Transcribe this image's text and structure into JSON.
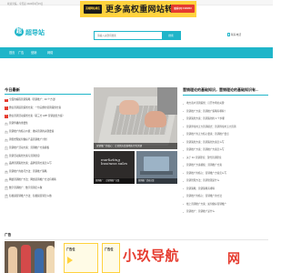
{
  "topbar": {
    "greeting": "欢迎光临，今天是 2024年4月15日"
  },
  "top_ad": {
    "tag": "高端网站域名",
    "headline": "更多高权重网站转让",
    "qq": "联系QQ:4110213"
  },
  "header": {
    "logo_mark": "超",
    "logo_name": "超导站",
    "search_placeholder": "请输入关键词搜索",
    "search_button": "搜索",
    "phone": "联系电话"
  },
  "nav": {
    "items": [
      "首页",
      "广告",
      "营销",
      "网络"
    ]
  },
  "today": {
    "title": "今日最新",
    "items": [
      "全面的编程营销策略（营销推广：40 个方法）",
      "微信营销运营策划方案：一份完整的营销策划方案",
      "微信营销活动策划方案（第三方 APP 营销最优方案）",
      "营销传播的重要性",
      "营销推广的核心价值：做好营销的关键要素",
      "销售经理如何做好产品营销推广计划",
      "营销推广活动方案：营销推广方案模板",
      "营销活动策划方案与营销创意",
      "品牌营销策划方案：品牌营销方案怎么写",
      "营销推广的技巧方法：营销推广策略",
      "网络营销推广方法：网络营销推广方法有哪些",
      "数字营销推广：数字营销怎么做",
      "短视频营销推广方法：短视频营销怎么做"
    ]
  },
  "feature": {
    "main_caption": "营销推广的核心：让营销方案落地执行的关键",
    "img1_text": "marketing business sales",
    "img1_caption": "营销推广：让营销推广方案",
    "img2_caption": "营销推广活动方案"
  },
  "right": {
    "title": "营销理论的基础知识，营销理论的基础知识有...",
    "items": [
      "地方商户营销策划：打开市场的关键",
      "营销推广方案：营销推广策略有哪些？",
      "营销策划方案：营销策划的 4 个步骤",
      "营销界常用五大营销模式：营销界常用五大营销",
      "营销推广的五大核心要素：营销推广要点",
      "营销策划方案：营销策划方案怎么写",
      "营销推广方案：营销推广方案怎么写",
      "关于 4C 营销理论：现代营销理论",
      "营销推广方案模板：营销推广方案",
      "营销推广的核心：营销推广方案怎么写",
      "营销管理方法：营销管理是什么",
      "营销策略：营销策略有哪些",
      "营销推广的核心：营销推广的方法",
      "线上营销推广方案：如何做好营销推广",
      "营销推广：营销推广是什么"
    ]
  },
  "ads": {
    "label": "广告",
    "tile1": "广告位",
    "tile2": "广告位",
    "big_text": "小玖导航",
    "big_sub": "网"
  },
  "colors": {
    "accent": "#1fb5c9",
    "banner": "#ffd23e",
    "hot": "#e63b2e"
  }
}
